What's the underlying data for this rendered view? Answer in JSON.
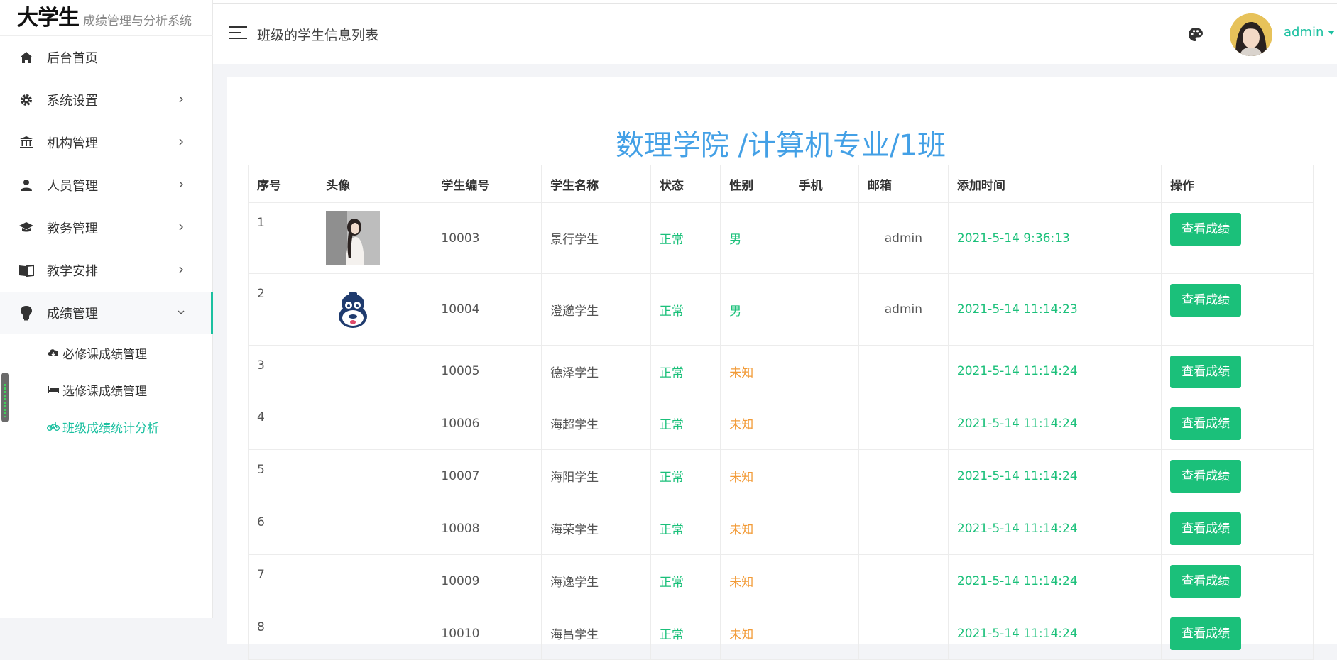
{
  "app": {
    "logo_main": "大学生",
    "logo_sub": "成绩管理与分析系统"
  },
  "sidebar": {
    "items": [
      {
        "label": "后台首页",
        "icon": "home-icon",
        "has_arrow": false
      },
      {
        "label": "系统设置",
        "icon": "gear-icon",
        "has_arrow": true
      },
      {
        "label": "机构管理",
        "icon": "bank-icon",
        "has_arrow": true
      },
      {
        "label": "人员管理",
        "icon": "user-icon",
        "has_arrow": true
      },
      {
        "label": "教务管理",
        "icon": "graduation-cap-icon",
        "has_arrow": true
      },
      {
        "label": "教学安排",
        "icon": "book-icon",
        "has_arrow": true
      },
      {
        "label": "成绩管理",
        "icon": "lightbulb-icon",
        "has_arrow": true,
        "expanded": true
      }
    ],
    "subitems": [
      {
        "label": "必修课成绩管理",
        "icon": "cloud-download-icon"
      },
      {
        "label": "选修课成绩管理",
        "icon": "bed-icon"
      },
      {
        "label": "班级成绩统计分析",
        "icon": "bicycle-icon",
        "current": true
      }
    ]
  },
  "header": {
    "title": "班级的学生信息列表",
    "user": "admin"
  },
  "content": {
    "class_title": "数理学院 /计算机专业/1班",
    "columns": [
      "序号",
      "头像",
      "学生编号",
      "学生名称",
      "状态",
      "性别",
      "手机",
      "邮箱",
      "添加时间",
      "操作"
    ],
    "button_label": "查看成绩",
    "rows": [
      {
        "idx": "1",
        "avatar": "photo",
        "id": "10003",
        "name": "景行学生",
        "status": "正常",
        "gender": "男",
        "phone": "",
        "email": "admin",
        "time": "2021-5-14 9:36:13"
      },
      {
        "idx": "2",
        "avatar": "monkey",
        "id": "10004",
        "name": "澄邈学生",
        "status": "正常",
        "gender": "男",
        "phone": "",
        "email": "admin",
        "time": "2021-5-14 11:14:23"
      },
      {
        "idx": "3",
        "avatar": "",
        "id": "10005",
        "name": "德泽学生",
        "status": "正常",
        "gender": "未知",
        "phone": "",
        "email": "",
        "time": "2021-5-14 11:14:24"
      },
      {
        "idx": "4",
        "avatar": "",
        "id": "10006",
        "name": "海超学生",
        "status": "正常",
        "gender": "未知",
        "phone": "",
        "email": "",
        "time": "2021-5-14 11:14:24"
      },
      {
        "idx": "5",
        "avatar": "",
        "id": "10007",
        "name": "海阳学生",
        "status": "正常",
        "gender": "未知",
        "phone": "",
        "email": "",
        "time": "2021-5-14 11:14:24"
      },
      {
        "idx": "6",
        "avatar": "",
        "id": "10008",
        "name": "海荣学生",
        "status": "正常",
        "gender": "未知",
        "phone": "",
        "email": "",
        "time": "2021-5-14 11:14:24"
      },
      {
        "idx": "7",
        "avatar": "",
        "id": "10009",
        "name": "海逸学生",
        "status": "正常",
        "gender": "未知",
        "phone": "",
        "email": "",
        "time": "2021-5-14 11:14:24"
      },
      {
        "idx": "8",
        "avatar": "",
        "id": "10010",
        "name": "海昌学生",
        "status": "正常",
        "gender": "未知",
        "phone": "",
        "email": "",
        "time": "2021-5-14 11:14:24"
      }
    ]
  },
  "colors": {
    "accent": "#1bc0a0",
    "button": "#1bc07a",
    "title_blue": "#43a0e6",
    "unknown": "#f29b38"
  }
}
